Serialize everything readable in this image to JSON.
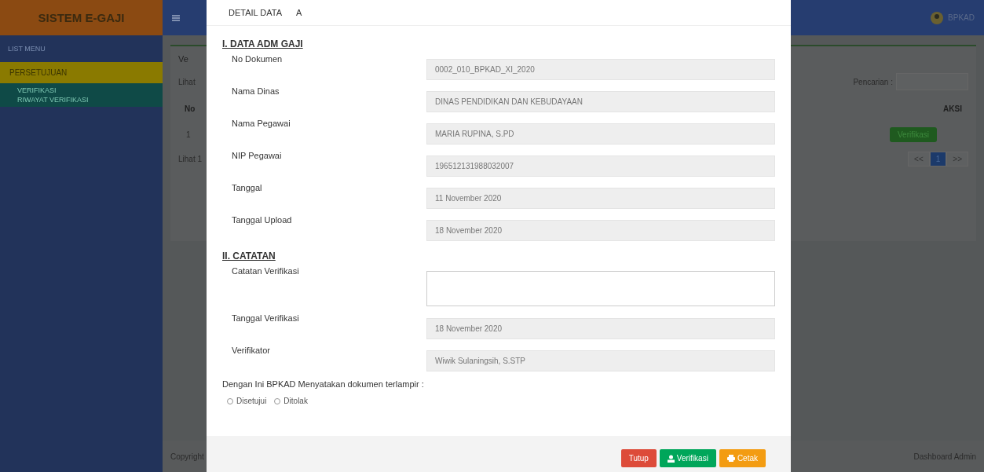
{
  "app": {
    "logo": "SISTEM E-GAJI",
    "menu_title": "LIST MENU",
    "user": "BPKAD"
  },
  "sidebar": {
    "items": [
      {
        "label": "PERSETUJUAN",
        "selected": true,
        "children": [
          {
            "label": "VERIFIKASI",
            "selected": false
          },
          {
            "label": "RIWAYAT VERIFIKASI",
            "selected": false
          }
        ]
      }
    ]
  },
  "background": {
    "tab": "Ve",
    "show_label": "Lihat",
    "search_label": "Pencarian :",
    "columns": [
      "No",
      "AKSI"
    ],
    "rows": [
      {
        "no": "1",
        "action": "Verifikasi"
      }
    ],
    "info": "Lihat 1",
    "pagination": [
      {
        "label": "<<",
        "selected": false
      },
      {
        "label": "1",
        "selected": true
      },
      {
        "label": ">>",
        "selected": false
      }
    ],
    "footer_left": "Copyright",
    "footer_right": "Dashboard Admin"
  },
  "modal": {
    "title": "DETAIL DATA",
    "title_suffix": "A",
    "section1": "I. DATA ADM GAJI",
    "fields1": [
      {
        "label": "No Dokumen",
        "value": "0002_010_BPKAD_XI_2020"
      },
      {
        "label": "Nama Dinas",
        "value": "DINAS PENDIDIKAN DAN KEBUDAYAAN"
      },
      {
        "label": "Nama Pegawai",
        "value": "MARIA RUPINA, S.PD"
      },
      {
        "label": "NIP Pegawai",
        "value": "196512131988032007"
      },
      {
        "label": "Tanggal",
        "value": "11 November 2020"
      },
      {
        "label": "Tanggal Upload",
        "value": "18 November 2020"
      }
    ],
    "section2": "II. CATATAN",
    "note_label": "Catatan Verifikasi",
    "fields2": [
      {
        "label": "Tanggal Verifikasi",
        "value": "18 November 2020"
      },
      {
        "label": "Verifikator",
        "value": "Wiwik Sulaningsih, S.STP"
      }
    ],
    "statement": "Dengan Ini BPKAD Menyatakan dokumen terlampir :",
    "options": [
      {
        "label": "Disetujui",
        "selected": false
      },
      {
        "label": "Ditolak",
        "selected": false
      }
    ],
    "buttons": [
      {
        "label": "Tutup",
        "kind": "close"
      },
      {
        "label": "Verifikasi",
        "kind": "verify"
      },
      {
        "label": "Cetak",
        "kind": "print"
      }
    ]
  }
}
